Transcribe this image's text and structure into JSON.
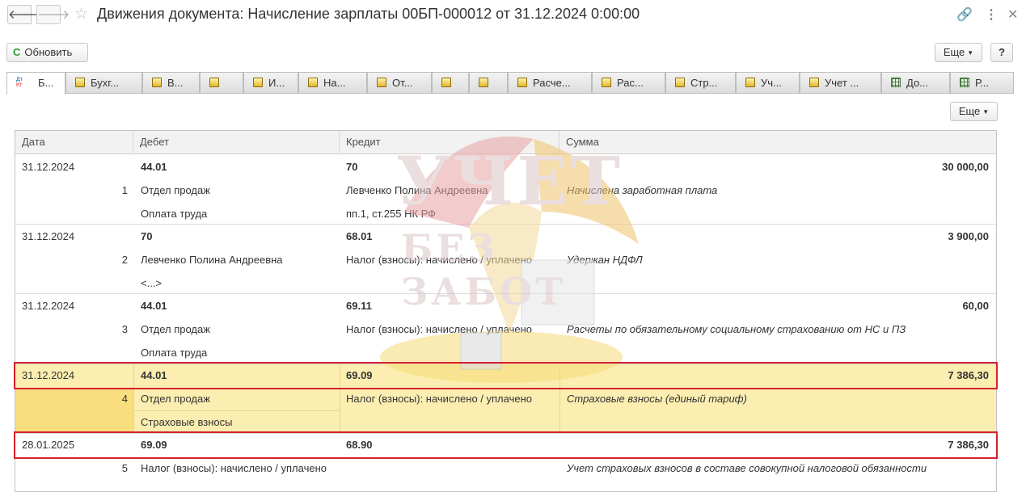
{
  "window": {
    "title": "Движения документа: Начисление зарплаты 00БП-000012 от 31.12.2024 0:00:00",
    "nav_back": "🡐",
    "nav_forward": "🡒",
    "star": "☆",
    "link_icon": "🔗",
    "menu_icon": "⋮",
    "close_icon": "✕"
  },
  "toolbar": {
    "refresh_icon": "C",
    "refresh_label": "Обновить",
    "more_label": "Еще",
    "help_label": "?"
  },
  "tabs": [
    {
      "label": "Б...",
      "icon": "dt-kt-icon"
    },
    {
      "label": "Бухг...",
      "icon": "register-icon"
    },
    {
      "label": "В...",
      "icon": "register-icon"
    },
    {
      "label": "",
      "icon": "register-icon"
    },
    {
      "label": "И...",
      "icon": "register-icon"
    },
    {
      "label": "На...",
      "icon": "register-icon"
    },
    {
      "label": "От...",
      "icon": "register-icon"
    },
    {
      "label": "",
      "icon": "register-icon"
    },
    {
      "label": "",
      "icon": "register-icon"
    },
    {
      "label": "Расче...",
      "icon": "register-icon"
    },
    {
      "label": "Рас...",
      "icon": "register-icon"
    },
    {
      "label": "Стр...",
      "icon": "register-icon"
    },
    {
      "label": "Уч...",
      "icon": "register-icon"
    },
    {
      "label": "Учет ...",
      "icon": "register-icon"
    },
    {
      "label": "До...",
      "icon": "table-icon"
    },
    {
      "label": "Р...",
      "icon": "table-icon"
    }
  ],
  "dt_icon": {
    "dt": "Дт",
    "kt": "Кт"
  },
  "panel": {
    "more_label": "Еще"
  },
  "table": {
    "columns": [
      "Дата",
      "Дебет",
      "Кредит",
      "Сумма"
    ],
    "rows": [
      {
        "date": "31.12.2024",
        "num": "1",
        "debit": "44.01",
        "debit_sub1": "Отдел продаж",
        "debit_sub2": "Оплата труда",
        "credit": "70",
        "credit_sub1": "Левченко Полина Андреевна",
        "credit_sub2": "пп.1, ст.255 НК РФ",
        "amount": "30 000,00",
        "content": "Начислена заработная плата"
      },
      {
        "date": "31.12.2024",
        "num": "2",
        "debit": "70",
        "debit_sub1": "Левченко Полина Андреевна",
        "debit_sub2": "<...>",
        "credit": "68.01",
        "credit_sub1": "Налог (взносы): начислено / уплачено",
        "credit_sub2": "",
        "amount": "3 900,00",
        "content": "Удержан НДФЛ"
      },
      {
        "date": "31.12.2024",
        "num": "3",
        "debit": "44.01",
        "debit_sub1": "Отдел продаж",
        "debit_sub2": "Оплата труда",
        "credit": "69.11",
        "credit_sub1": "Налог (взносы): начислено / уплачено",
        "credit_sub2": "",
        "amount": "60,00",
        "content": "Расчеты по обязательному социальному страхованию от НС и ПЗ"
      },
      {
        "date": "31.12.2024",
        "num": "4",
        "debit": "44.01",
        "debit_sub1": "Отдел продаж",
        "debit_sub2": "Страховые взносы",
        "credit": "69.09",
        "credit_sub1": "Налог (взносы): начислено / уплачено",
        "credit_sub2": "",
        "amount": "7 386,30",
        "content": "Страховые взносы (единый тариф)"
      },
      {
        "date": "28.01.2025",
        "num": "5",
        "debit": "69.09",
        "debit_sub1": "Налог (взносы): начислено / уплачено",
        "debit_sub2": "",
        "credit": "68.90",
        "credit_sub1": "",
        "credit_sub2": "",
        "amount": "7 386,30",
        "content": "Учет страховых взносов в составе совокупной налоговой обязанности"
      }
    ]
  },
  "watermark": {
    "line1": "УЧЕТ",
    "line2": "БЕЗ ЗАБОТ"
  },
  "colors": {
    "highlight": "#fbeeb0",
    "selection": "#f8de7e",
    "red_frame": "#d3212c",
    "refresh_green": "#2f9a3a"
  }
}
